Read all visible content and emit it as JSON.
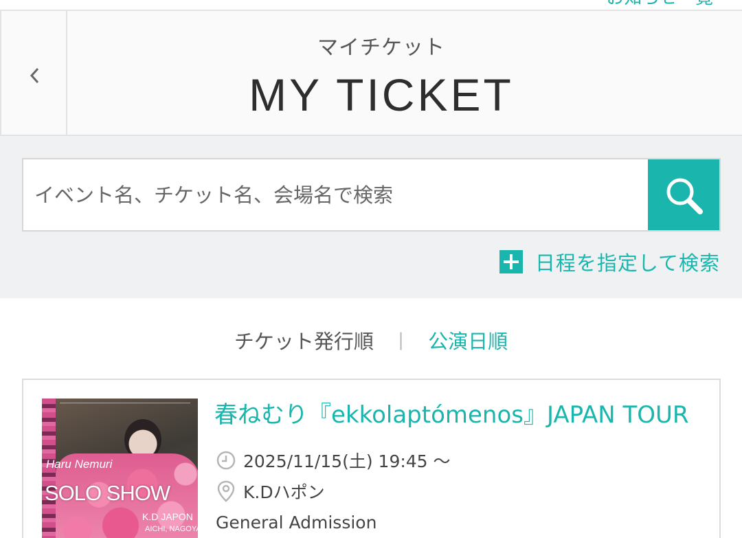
{
  "top_link": {
    "label": "お知らせ一覧"
  },
  "header": {
    "title_ja": "マイチケット",
    "title_en": "MY TICKET"
  },
  "search": {
    "placeholder": "イベント名、チケット名、会場名で検索",
    "value": "",
    "date_search_label": "日程を指定して検索"
  },
  "sort": {
    "by_issue": "チケット発行順",
    "divider": "|",
    "by_date": "公演日順",
    "active": "by_date"
  },
  "tickets": [
    {
      "title": "春ねむり『ekkolaptómenos』JAPAN TOUR",
      "datetime": "2025/11/15(土) 19:45 〜",
      "venue": "K.Dハポン",
      "ticket_type": "General Admission",
      "thumbnail": {
        "artist": "Haru Nemuri",
        "show": "SOLO SHOW",
        "venue": "K.D JAPON",
        "city": "AICHI, NAGOYA"
      }
    }
  ],
  "colors": {
    "accent": "#1ab5ac",
    "header_bg": "#fafafa",
    "search_bg": "#eff1f2",
    "text": "#333333"
  },
  "icons": {
    "back": "chevron-left-icon",
    "search": "magnifier-icon",
    "add": "plus-icon",
    "time": "clock-icon",
    "location": "map-pin-icon"
  }
}
